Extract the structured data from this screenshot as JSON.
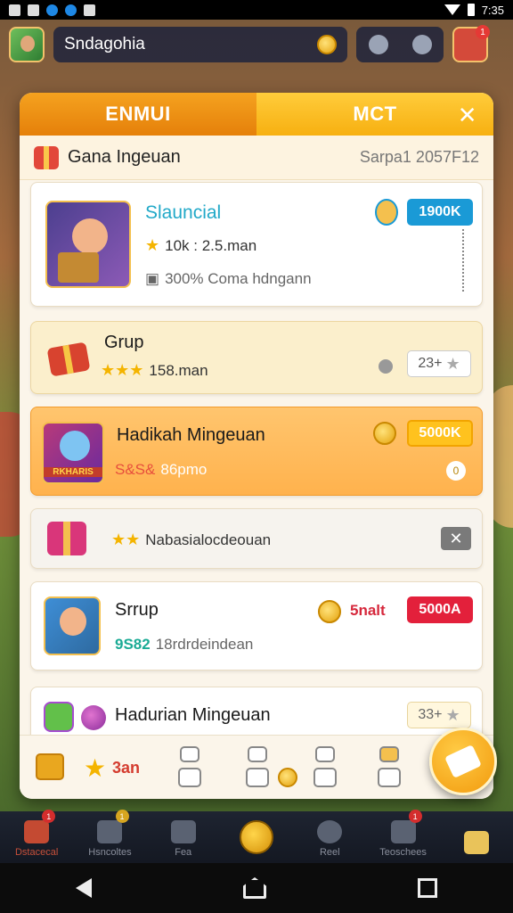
{
  "statusbar": {
    "time": "7:35"
  },
  "topbar": {
    "player_name": "Sndagohia",
    "gift_badge": "1"
  },
  "panel": {
    "tabs": [
      {
        "label": "ENMUI"
      },
      {
        "label": "MCT"
      }
    ],
    "close_label": "✕",
    "section_title": "Gana Ingeuan",
    "section_right": "Sarpa1 2057F12",
    "cards": [
      {
        "title": "Slauncial",
        "meta1": "10k : 2.5.man",
        "meta2": "300% Coma hdngann",
        "tag": "1900K"
      },
      {
        "title": "Grup",
        "meta1": "158.man",
        "tag": "23+"
      },
      {
        "title": "Hadikah Mingeuan",
        "thumb_label": "RKHARIS",
        "meta1_red": "S&S&",
        "meta1": "86pmo",
        "tag": "5000K",
        "circle_label": "0"
      },
      {
        "meta1": "Nabasialocdeouan",
        "close_label": "✕"
      },
      {
        "title": "Srrup",
        "meta1_teal": "9S82",
        "meta1": "18rdrdeindean",
        "coin_label": "5nalt",
        "tag": "5000A"
      },
      {
        "title": "Hadurian Mingeuan",
        "tag": "33+"
      }
    ],
    "bottom": {
      "count": "3an"
    }
  },
  "gamenav": [
    {
      "label": "Dstacecal",
      "badge": "1"
    },
    {
      "label": "Hsncoltes",
      "badge": "1"
    },
    {
      "label": "Fea"
    },
    {
      "label": ""
    },
    {
      "label": "Reel"
    },
    {
      "label": "Teoschees",
      "badge": "1"
    },
    {
      "label": ""
    }
  ]
}
